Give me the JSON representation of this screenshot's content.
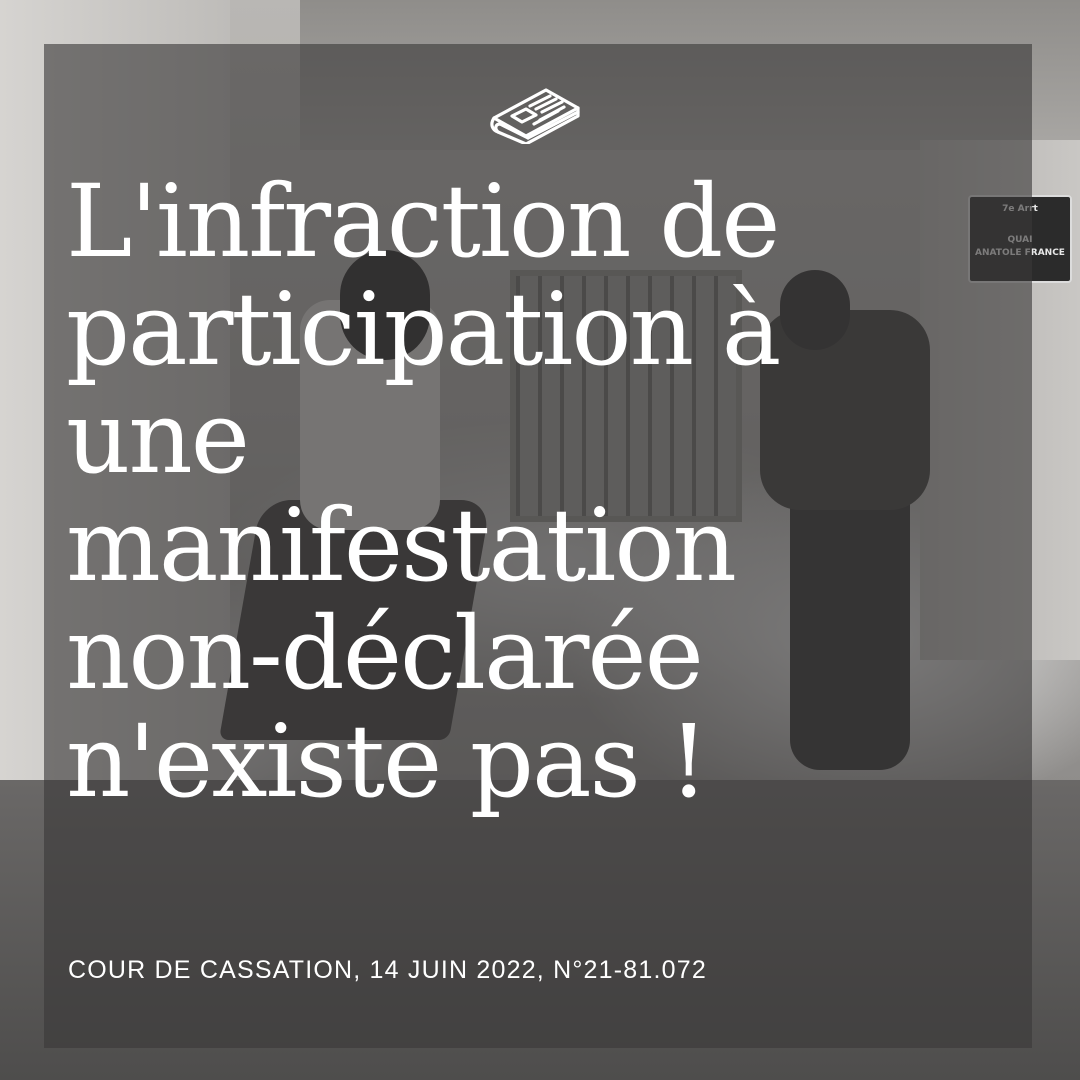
{
  "photo": {
    "street_sign": {
      "arrondissement": "7e Arrt",
      "line1": "QUAI",
      "line2": "ANATOLE FRANCE"
    }
  },
  "icon": "newspaper-icon",
  "headline_lines": [
    "L'infraction de",
    "participation à",
    "une",
    "manifestation",
    "non-déclarée",
    "n'existe pas !"
  ],
  "subtitle": "COUR DE CASSATION, 14 JUIN 2022, N°21-81.072",
  "colors": {
    "overlay": "#3a3838",
    "text": "#ffffff"
  }
}
